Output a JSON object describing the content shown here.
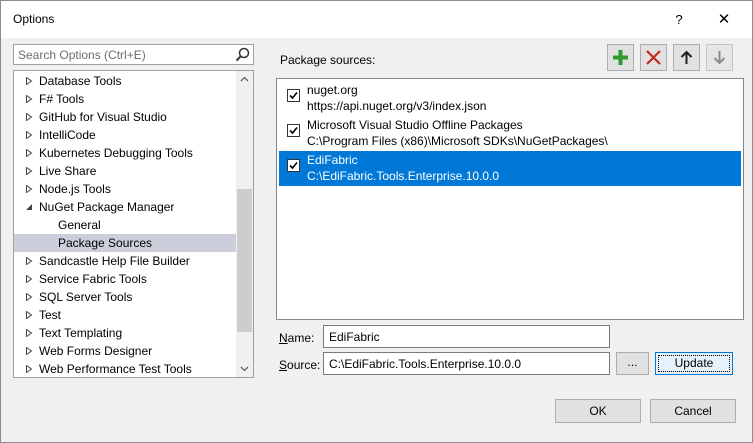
{
  "window": {
    "title": "Options",
    "help_label": "?",
    "close_label": "✕"
  },
  "search": {
    "placeholder": "Search Options (Ctrl+E)"
  },
  "tree": {
    "items": [
      {
        "label": "Database Tools",
        "expanded": false
      },
      {
        "label": "F# Tools",
        "expanded": false
      },
      {
        "label": "GitHub for Visual Studio",
        "expanded": false
      },
      {
        "label": "IntelliCode",
        "expanded": false
      },
      {
        "label": "Kubernetes Debugging Tools",
        "expanded": false
      },
      {
        "label": "Live Share",
        "expanded": false
      },
      {
        "label": "Node.js Tools",
        "expanded": false
      },
      {
        "label": "NuGet Package Manager",
        "expanded": true
      },
      {
        "label": "General",
        "child": true
      },
      {
        "label": "Package Sources",
        "child": true,
        "selected": true
      },
      {
        "label": "Sandcastle Help File Builder",
        "expanded": false
      },
      {
        "label": "Service Fabric Tools",
        "expanded": false
      },
      {
        "label": "SQL Server Tools",
        "expanded": false
      },
      {
        "label": "Test",
        "expanded": false
      },
      {
        "label": "Text Templating",
        "expanded": false
      },
      {
        "label": "Web Forms Designer",
        "expanded": false
      },
      {
        "label": "Web Performance Test Tools",
        "expanded": false
      }
    ]
  },
  "package_sources": {
    "label": "Package sources:",
    "toolbar": {
      "add_icon": "plus-icon",
      "remove_icon": "x-icon",
      "up_icon": "arrow-up-icon",
      "down_icon": "arrow-down-icon"
    },
    "items": [
      {
        "name": "nuget.org",
        "url": "https://api.nuget.org/v3/index.json",
        "checked": true,
        "selected": false
      },
      {
        "name": "Microsoft Visual Studio Offline Packages",
        "url": "C:\\Program Files (x86)\\Microsoft SDKs\\NuGetPackages\\",
        "checked": true,
        "selected": false
      },
      {
        "name": "EdiFabric",
        "url": "C:\\EdiFabric.Tools.Enterprise.10.0.0",
        "checked": true,
        "selected": true
      }
    ]
  },
  "form": {
    "name_label_u": "N",
    "name_label_rest": "ame:",
    "name_value": "EdiFabric",
    "source_label_u": "S",
    "source_label_rest": "ource:",
    "source_value": "C:\\EdiFabric.Tools.Enterprise.10.0.0",
    "browse_label": "...",
    "update_label": "Update"
  },
  "buttons": {
    "ok": "OK",
    "cancel": "Cancel"
  },
  "colors": {
    "accent": "#0078d7",
    "add_green": "#2e9b2e",
    "remove_red": "#c42b1c",
    "tree_selected": "#cccedb"
  }
}
